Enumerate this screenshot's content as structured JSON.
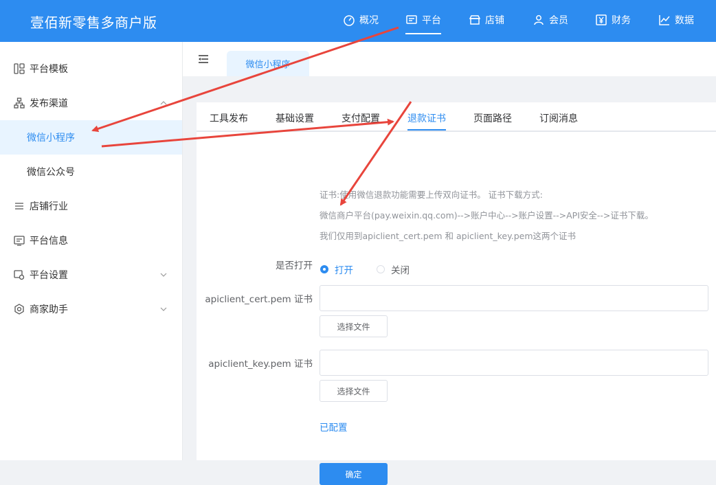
{
  "brand": "壹佰新零售多商户版",
  "topnav": [
    {
      "label": "概况",
      "icon": "dashboard-icon"
    },
    {
      "label": "平台",
      "icon": "platform-icon"
    },
    {
      "label": "店铺",
      "icon": "store-icon"
    },
    {
      "label": "会员",
      "icon": "user-icon"
    },
    {
      "label": "财务",
      "icon": "yen-icon"
    },
    {
      "label": "数据",
      "icon": "chart-line-icon"
    }
  ],
  "sidebar": {
    "items": [
      {
        "label": "平台模板",
        "icon": "template-icon"
      },
      {
        "label": "发布渠道",
        "icon": "channels-icon"
      },
      {
        "label": "微信小程序"
      },
      {
        "label": "微信公众号"
      },
      {
        "label": "店铺行业",
        "icon": "list-icon"
      },
      {
        "label": "平台信息",
        "icon": "info-icon"
      },
      {
        "label": "平台设置",
        "icon": "settings-icon"
      },
      {
        "label": "商家助手",
        "icon": "helper-icon"
      }
    ]
  },
  "page_tab": "微信小程序",
  "subtabs": [
    "工具发布",
    "基础设置",
    "支付配置",
    "退款证书",
    "页面路径",
    "订阅消息"
  ],
  "hints": [
    "证书:使用微信退款功能需要上传双向证书。 证书下载方式:",
    "微信商户平台(pay.weixin.qq.com)-->账户中心-->账户设置-->API安全-->证书下载。",
    "我们仅用到apiclient_cert.pem 和 apiclient_key.pem这两个证书"
  ],
  "form": {
    "open_label": "是否打开",
    "open_on": "打开",
    "open_off": "关闭",
    "cert_label": "apiclient_cert.pem 证书",
    "key_label": "apiclient_key.pem 证书",
    "cert_value": "",
    "key_value": "",
    "choose_file": "选择文件",
    "status": "已配置",
    "confirm": "确定"
  },
  "colors": {
    "primary": "#2d8cf0",
    "annotation": "#e8453c"
  }
}
